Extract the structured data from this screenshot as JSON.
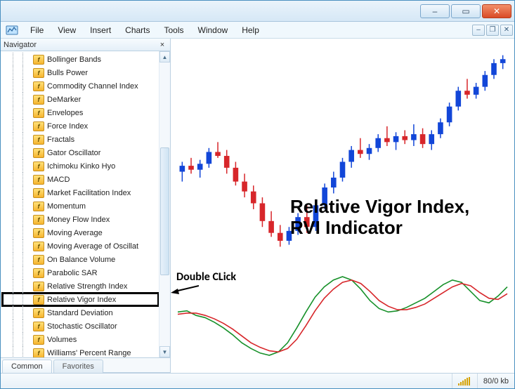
{
  "menu": {
    "file": "File",
    "view": "View",
    "insert": "Insert",
    "charts": "Charts",
    "tools": "Tools",
    "window": "Window",
    "help": "Help"
  },
  "navigator": {
    "title": "Navigator",
    "tabs": {
      "common": "Common",
      "favorites": "Favorites"
    },
    "items": [
      {
        "label": "Bollinger Bands"
      },
      {
        "label": "Bulls Power"
      },
      {
        "label": "Commodity Channel Index"
      },
      {
        "label": "DeMarker"
      },
      {
        "label": "Envelopes"
      },
      {
        "label": "Force Index"
      },
      {
        "label": "Fractals"
      },
      {
        "label": "Gator Oscillator"
      },
      {
        "label": "Ichimoku Kinko Hyo"
      },
      {
        "label": "MACD"
      },
      {
        "label": "Market Facilitation Index"
      },
      {
        "label": "Momentum"
      },
      {
        "label": "Money Flow Index"
      },
      {
        "label": "Moving Average"
      },
      {
        "label": "Moving Average of Oscillat"
      },
      {
        "label": "On Balance Volume"
      },
      {
        "label": "Parabolic SAR"
      },
      {
        "label": "Relative Strength Index"
      },
      {
        "label": "Relative Vigor Index"
      },
      {
        "label": "Standard Deviation"
      },
      {
        "label": "Stochastic Oscillator"
      },
      {
        "label": "Volumes"
      },
      {
        "label": "Williams' Percent Range"
      }
    ],
    "highlight_index": 18
  },
  "chart": {
    "title_line1": "Relative Vigor Index,",
    "title_line2": "RVI Indicator",
    "annotation_doubleclick": "Double CLick"
  },
  "chart_data": {
    "type": "candlestick+line",
    "panels": [
      {
        "type": "candlestick",
        "up_color": "#1246d8",
        "down_color": "#d7262a",
        "candles": [
          {
            "o": 113,
            "h": 118,
            "l": 108,
            "c": 116,
            "dir": "up"
          },
          {
            "o": 116,
            "h": 120,
            "l": 112,
            "c": 114,
            "dir": "down"
          },
          {
            "o": 114,
            "h": 119,
            "l": 110,
            "c": 117,
            "dir": "up"
          },
          {
            "o": 117,
            "h": 125,
            "l": 115,
            "c": 123,
            "dir": "up"
          },
          {
            "o": 123,
            "h": 128,
            "l": 120,
            "c": 121,
            "dir": "down"
          },
          {
            "o": 121,
            "h": 124,
            "l": 112,
            "c": 115,
            "dir": "down"
          },
          {
            "o": 115,
            "h": 118,
            "l": 106,
            "c": 108,
            "dir": "down"
          },
          {
            "o": 108,
            "h": 112,
            "l": 100,
            "c": 103,
            "dir": "down"
          },
          {
            "o": 103,
            "h": 106,
            "l": 94,
            "c": 97,
            "dir": "down"
          },
          {
            "o": 97,
            "h": 100,
            "l": 85,
            "c": 88,
            "dir": "down"
          },
          {
            "o": 88,
            "h": 93,
            "l": 80,
            "c": 82,
            "dir": "down"
          },
          {
            "o": 82,
            "h": 86,
            "l": 75,
            "c": 78,
            "dir": "down"
          },
          {
            "o": 78,
            "h": 85,
            "l": 76,
            "c": 83,
            "dir": "up"
          },
          {
            "o": 83,
            "h": 92,
            "l": 81,
            "c": 90,
            "dir": "up"
          },
          {
            "o": 90,
            "h": 96,
            "l": 82,
            "c": 85,
            "dir": "down"
          },
          {
            "o": 85,
            "h": 98,
            "l": 83,
            "c": 96,
            "dir": "up"
          },
          {
            "o": 96,
            "h": 107,
            "l": 94,
            "c": 105,
            "dir": "up"
          },
          {
            "o": 105,
            "h": 113,
            "l": 102,
            "c": 110,
            "dir": "up"
          },
          {
            "o": 110,
            "h": 120,
            "l": 108,
            "c": 118,
            "dir": "up"
          },
          {
            "o": 118,
            "h": 126,
            "l": 115,
            "c": 124,
            "dir": "up"
          },
          {
            "o": 124,
            "h": 130,
            "l": 120,
            "c": 122,
            "dir": "down"
          },
          {
            "o": 122,
            "h": 127,
            "l": 119,
            "c": 125,
            "dir": "up"
          },
          {
            "o": 125,
            "h": 132,
            "l": 123,
            "c": 130,
            "dir": "up"
          },
          {
            "o": 130,
            "h": 136,
            "l": 126,
            "c": 128,
            "dir": "down"
          },
          {
            "o": 128,
            "h": 133,
            "l": 124,
            "c": 131,
            "dir": "up"
          },
          {
            "o": 131,
            "h": 134,
            "l": 127,
            "c": 129,
            "dir": "down"
          },
          {
            "o": 129,
            "h": 137,
            "l": 126,
            "c": 132,
            "dir": "up"
          },
          {
            "o": 132,
            "h": 135,
            "l": 125,
            "c": 127,
            "dir": "down"
          },
          {
            "o": 127,
            "h": 134,
            "l": 124,
            "c": 132,
            "dir": "up"
          },
          {
            "o": 132,
            "h": 140,
            "l": 130,
            "c": 138,
            "dir": "up"
          },
          {
            "o": 138,
            "h": 148,
            "l": 136,
            "c": 146,
            "dir": "up"
          },
          {
            "o": 146,
            "h": 156,
            "l": 144,
            "c": 154,
            "dir": "up"
          },
          {
            "o": 154,
            "h": 160,
            "l": 150,
            "c": 152,
            "dir": "down"
          },
          {
            "o": 152,
            "h": 158,
            "l": 150,
            "c": 156,
            "dir": "up"
          },
          {
            "o": 156,
            "h": 164,
            "l": 154,
            "c": 162,
            "dir": "up"
          },
          {
            "o": 162,
            "h": 170,
            "l": 160,
            "c": 168,
            "dir": "up"
          },
          {
            "o": 168,
            "h": 172,
            "l": 165,
            "c": 170,
            "dir": "up"
          }
        ]
      },
      {
        "type": "line",
        "series": [
          {
            "name": "RVI",
            "color": "#17912a",
            "values": [
              0.02,
              0.03,
              -0.01,
              -0.03,
              -0.07,
              -0.12,
              -0.18,
              -0.25,
              -0.3,
              -0.34,
              -0.36,
              -0.33,
              -0.25,
              -0.12,
              0.02,
              0.15,
              0.24,
              0.3,
              0.33,
              0.3,
              0.22,
              0.12,
              0.05,
              0.02,
              0.03,
              0.06,
              0.1,
              0.14,
              0.2,
              0.26,
              0.3,
              0.28,
              0.2,
              0.12,
              0.1,
              0.16,
              0.24
            ]
          },
          {
            "name": "Signal",
            "color": "#d7262a",
            "values": [
              0.0,
              0.01,
              0.01,
              -0.01,
              -0.04,
              -0.08,
              -0.13,
              -0.19,
              -0.25,
              -0.29,
              -0.32,
              -0.33,
              -0.3,
              -0.22,
              -0.1,
              0.03,
              0.14,
              0.22,
              0.28,
              0.3,
              0.27,
              0.2,
              0.12,
              0.07,
              0.04,
              0.04,
              0.06,
              0.09,
              0.14,
              0.19,
              0.24,
              0.27,
              0.25,
              0.19,
              0.14,
              0.13,
              0.18
            ]
          }
        ]
      }
    ]
  },
  "status": {
    "transfer": "80/0 kb"
  }
}
